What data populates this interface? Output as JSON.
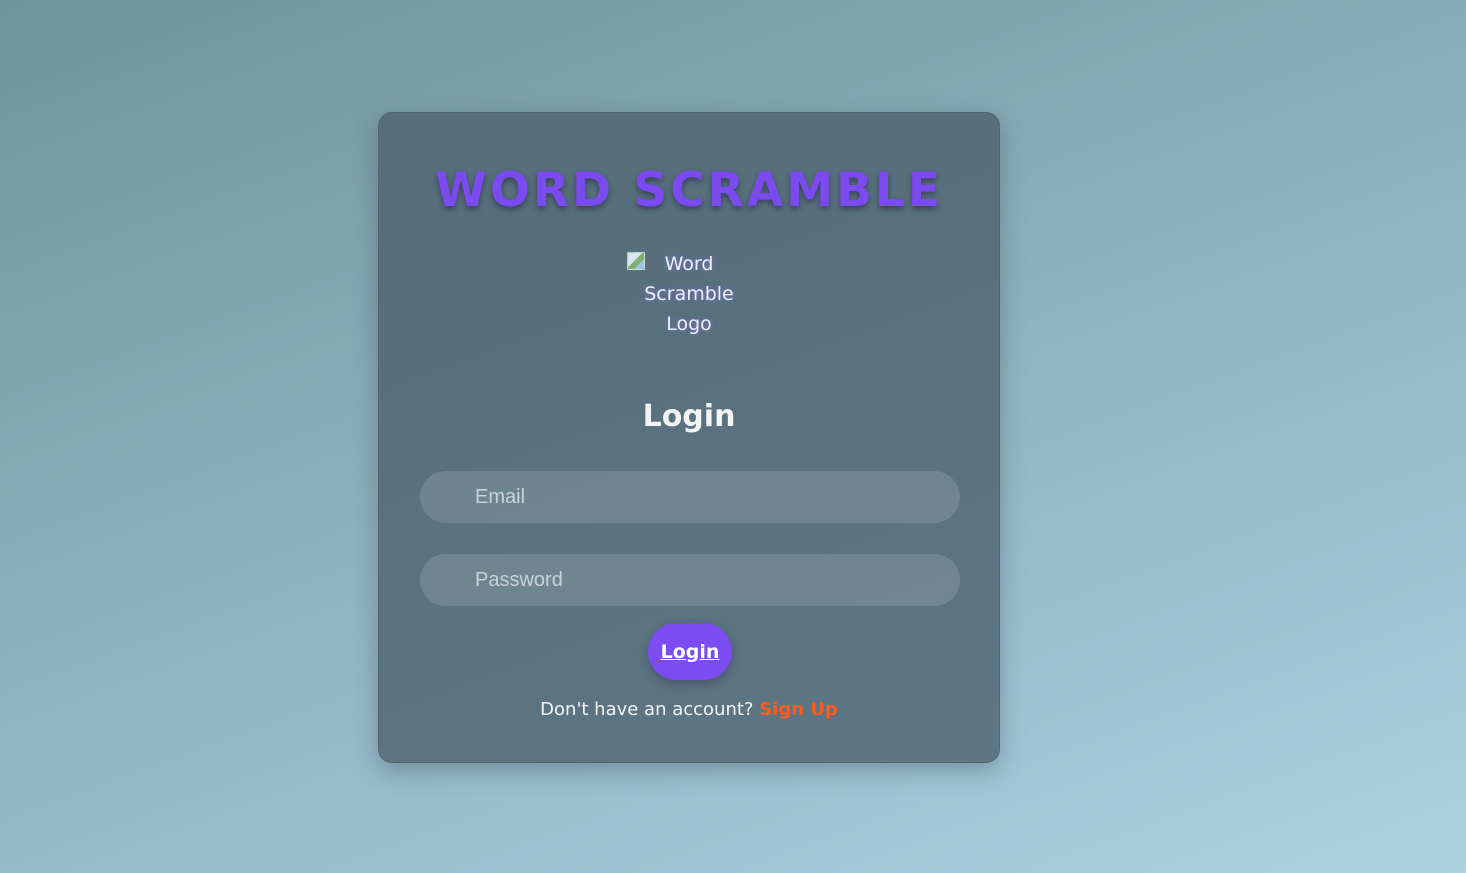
{
  "app": {
    "title": "WORD SCRAMBLE",
    "logo_alt": "Word Scramble Logo"
  },
  "login": {
    "heading": "Login",
    "email_placeholder": "Email",
    "password_placeholder": "Password",
    "submit_label": "Login",
    "signup_prompt": "Don't have an account?",
    "signup_link": "Sign Up"
  },
  "colors": {
    "accent": "#7c4cf2",
    "link": "#ff5a1f",
    "card": "#4a606c"
  },
  "icons": {
    "logo": "broken-image-icon"
  }
}
